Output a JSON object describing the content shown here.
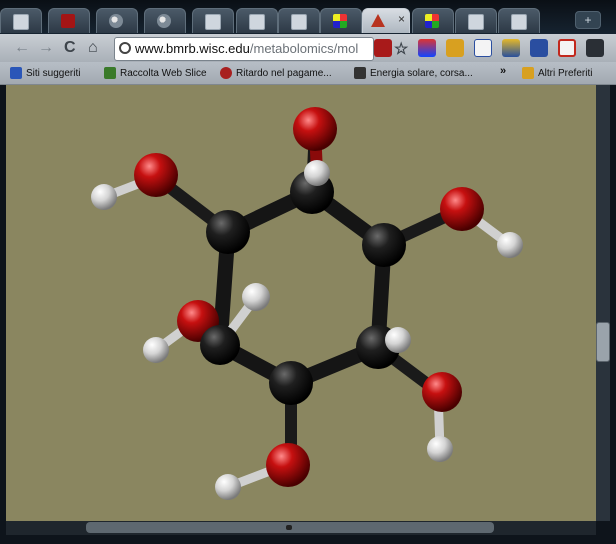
{
  "browser": {
    "tabs": [
      {
        "icon": "doc-icon"
      },
      {
        "icon": "red-square-icon"
      },
      {
        "icon": "swirl-icon"
      },
      {
        "icon": "swirl-icon"
      },
      {
        "icon": "doc-icon"
      },
      {
        "icon": "doc-icon"
      },
      {
        "icon": "doc-icon"
      },
      {
        "icon": "msn-icon"
      },
      {
        "icon": "molecule-site-icon",
        "active": true,
        "close_label": "×"
      },
      {
        "icon": "msn-icon"
      },
      {
        "icon": "doc-icon"
      },
      {
        "icon": "new-tab-icon"
      }
    ],
    "new_tab_label": "+",
    "toolbar": {
      "back": "←",
      "forward": "→",
      "reload": "C",
      "home": "⌂",
      "url_domain": "www.bmrb.wisc.edu",
      "url_path": "/metabolomics/mol",
      "star": "☆"
    },
    "bookmarks": [
      {
        "label": "Siti suggeriti"
      },
      {
        "label": "Raccolta Web Slice"
      },
      {
        "label": "Ritardo nel pagame..."
      },
      {
        "label": "Energia solare, corsa..."
      }
    ],
    "bookmarks_overflow": "»",
    "other_bookmarks": "Altri Preferiti"
  },
  "viewer": {
    "background_color": "#8a8660",
    "carbon_color": "#1a1a1a",
    "oxygen_color": "#c41212",
    "hydrogen_color": "#e8e8e8"
  }
}
